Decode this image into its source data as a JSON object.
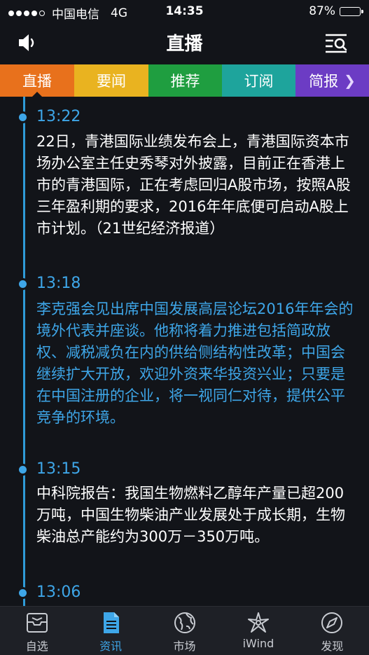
{
  "status": {
    "carrier": "中国电信",
    "network": "4G",
    "time": "14:35",
    "battery": "87%",
    "battery_level": 0.87
  },
  "header": {
    "title": "直播"
  },
  "tabs": [
    {
      "label": "直播",
      "color": "#e8711c"
    },
    {
      "label": "要闻",
      "color": "#e9b320"
    },
    {
      "label": "推荐",
      "color": "#1f9e40"
    },
    {
      "label": "订阅",
      "color": "#1ea49c"
    },
    {
      "label": "简报",
      "color": "#6c3cc4"
    }
  ],
  "feed": [
    {
      "time": "13:22",
      "text": "22日，青港国际业绩发布会上，青港国际资本市场办公室主任史秀琴对外披露，目前正在香港上市的青港国际，正在考虑回归A股市场，按照A股三年盈利期的要求，2016年年底便可启动A股上市计划。（21世纪经济报道）",
      "highlighted": false
    },
    {
      "time": "13:18",
      "text": "李克强会见出席中国发展高层论坛2016年年会的境外代表并座谈。他称将着力推进包括简政放权、减税减负在内的供给侧结构性改革；中国会继续扩大开放，欢迎外资来华投资兴业；只要是在中国注册的企业，将一视同仁对待，提供公平竞争的环境。",
      "highlighted": true
    },
    {
      "time": "13:15",
      "text": "中科院报告：我国生物燃料乙醇年产量已超200万吨，中国生物柴油产业发展处于成长期，生物柴油总产能约为300万－350万吨。",
      "highlighted": false
    },
    {
      "time": "13:06",
      "text": "",
      "highlighted": false
    }
  ],
  "bottom_nav": [
    {
      "label": "自选",
      "icon": "inbox-tray-icon"
    },
    {
      "label": "资讯",
      "icon": "document-icon",
      "active": true
    },
    {
      "label": "市场",
      "icon": "globe-icon"
    },
    {
      "label": "iWind",
      "icon": "iwind-logo-icon"
    },
    {
      "label": "发现",
      "icon": "compass-icon"
    }
  ],
  "colors": {
    "accent": "#3ea6e8",
    "background": "#121419"
  }
}
